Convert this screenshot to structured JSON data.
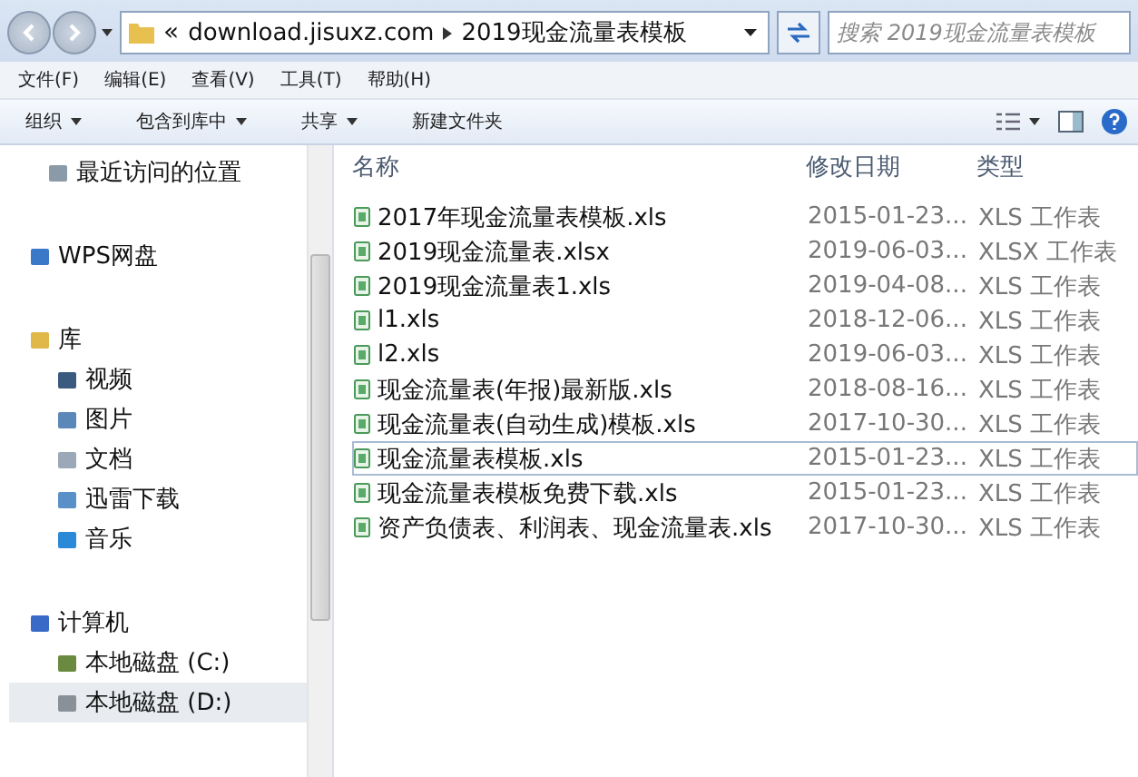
{
  "address_bar": {
    "path": [
      "download.jisuxz.com",
      "2019现金流量表模板"
    ],
    "prefix": "«"
  },
  "search": {
    "placeholder": "搜索 2019现金流量表模板"
  },
  "menu": [
    "文件(F)",
    "编辑(E)",
    "查看(V)",
    "工具(T)",
    "帮助(H)"
  ],
  "toolbar": [
    {
      "label": "组织",
      "dropdown": true
    },
    {
      "label": "包含到库中",
      "dropdown": true
    },
    {
      "label": "共享",
      "dropdown": true
    },
    {
      "label": "新建文件夹",
      "dropdown": false
    }
  ],
  "sidebar": {
    "groups": [
      {
        "label": "最近访问的位置"
      },
      {
        "label": "WPS网盘"
      },
      {
        "label": "库",
        "children": [
          {
            "label": "视频",
            "selected": false
          },
          {
            "label": "图片",
            "selected": false
          },
          {
            "label": "文档",
            "selected": false
          },
          {
            "label": "迅雷下载",
            "selected": false
          },
          {
            "label": "音乐",
            "selected": false
          }
        ]
      },
      {
        "label": "计算机",
        "children": [
          {
            "label": "本地磁盘 (C:)",
            "selected": false
          },
          {
            "label": "本地磁盘 (D:)",
            "selected": true
          }
        ]
      }
    ]
  },
  "table": {
    "columns": [
      "名称",
      "修改日期",
      "类型"
    ],
    "rows": [
      {
        "name": "2017年现金流量表模板.xls",
        "date": "2015-01-23...",
        "type": "XLS 工作表",
        "selected": false
      },
      {
        "name": "2019现金流量表.xlsx",
        "date": "2019-06-03...",
        "type": "XLSX 工作表",
        "selected": false
      },
      {
        "name": "2019现金流量表1.xls",
        "date": "2019-04-08...",
        "type": "XLS 工作表",
        "selected": false
      },
      {
        "name": "l1.xls",
        "date": "2018-12-06...",
        "type": "XLS 工作表",
        "selected": false
      },
      {
        "name": "l2.xls",
        "date": "2019-06-03...",
        "type": "XLS 工作表",
        "selected": false
      },
      {
        "name": "现金流量表(年报)最新版.xls",
        "date": "2018-08-16...",
        "type": "XLS 工作表",
        "selected": false
      },
      {
        "name": "现金流量表(自动生成)模板.xls",
        "date": "2017-10-30...",
        "type": "XLS 工作表",
        "selected": false
      },
      {
        "name": "现金流量表模板.xls",
        "date": "2015-01-23...",
        "type": "XLS 工作表",
        "selected": true
      },
      {
        "name": "现金流量表模板免费下载.xls",
        "date": "2015-01-23...",
        "type": "XLS 工作表",
        "selected": false
      },
      {
        "name": "资产负债表、利润表、现金流量表.xls",
        "date": "2017-10-30...",
        "type": "XLS 工作表",
        "selected": false
      }
    ]
  }
}
